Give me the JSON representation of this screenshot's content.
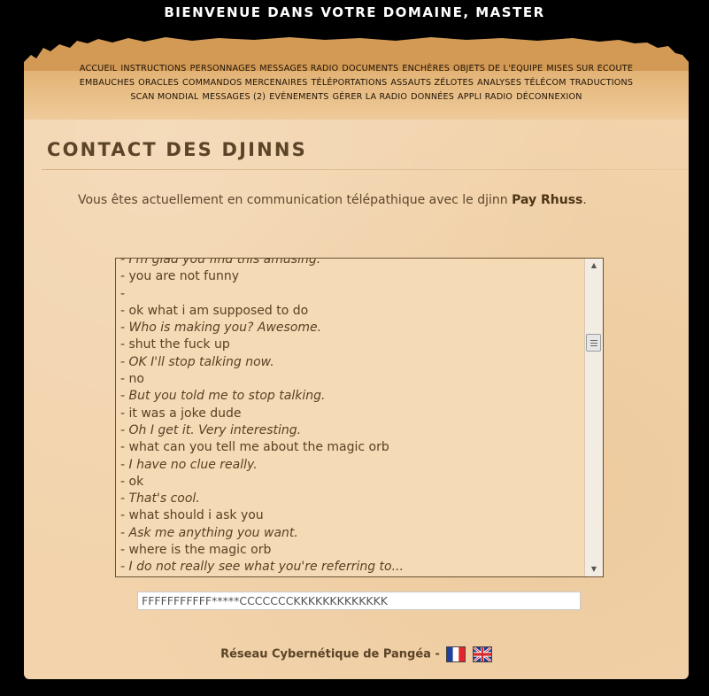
{
  "header": {
    "title": "BIENVENUE DANS VOTRE DOMAINE, MASTER"
  },
  "nav": {
    "row1": [
      "ACCUEIL",
      "INSTRUCTIONS",
      "PERSONNAGES",
      "MESSAGES RADIO",
      "DOCUMENTS",
      "ENCHÈRES",
      "OBJETS DE L'EQUIPE",
      "MISES SUR ECOUTE"
    ],
    "row2": [
      "EMBAUCHES",
      "ORACLES",
      "COMMANDOS MERCENAIRES",
      "TÉLÉPORTATIONS",
      "ASSAUTS ZÉLOTES",
      "ANALYSES TÉLÉCOM",
      "TRADUCTIONS"
    ],
    "row3": [
      "SCAN MONDIAL",
      "MESSAGES (2)",
      "EVÈNEMENTS",
      "GÉRER LA RADIO",
      "DONNÉES",
      "APPLI RADIO",
      "DÉCONNEXION"
    ]
  },
  "page": {
    "title": "CONTACT DES DJINNS",
    "intro_text": "Vous êtes actuellement en communication télépathique avec le djinn ",
    "djinn_name": "Pay Rhuss",
    "intro_end": "."
  },
  "chat": {
    "lines": [
      {
        "text": "- I'm glad you find this amusing.",
        "who": "bot"
      },
      {
        "text": "- you are not funny",
        "who": "user"
      },
      {
        "text": "-",
        "who": "user"
      },
      {
        "text": "- ok what i am supposed to do",
        "who": "user"
      },
      {
        "text": "- Who is making you? Awesome.",
        "who": "bot"
      },
      {
        "text": "- shut the fuck up",
        "who": "user"
      },
      {
        "text": "- OK I'll stop talking now.",
        "who": "bot"
      },
      {
        "text": "- no",
        "who": "user"
      },
      {
        "text": "- But you told me to stop talking.",
        "who": "bot"
      },
      {
        "text": "- it was a joke dude",
        "who": "user"
      },
      {
        "text": "- Oh I get it. Very interesting.",
        "who": "bot"
      },
      {
        "text": "- what can you tell me about the magic orb",
        "who": "user"
      },
      {
        "text": "- I have no clue really.",
        "who": "bot"
      },
      {
        "text": "- ok",
        "who": "user"
      },
      {
        "text": "- That's cool.",
        "who": "bot"
      },
      {
        "text": "- what should i ask you",
        "who": "user"
      },
      {
        "text": "- Ask me anything you want.",
        "who": "bot"
      },
      {
        "text": "- where is the magic orb",
        "who": "user"
      },
      {
        "text": "- I do not really see what you're referring to...",
        "who": "bot"
      }
    ]
  },
  "input": {
    "value": "FFFFFFFFFFF*****CCCCCCCKKKKKKKKKKKKK"
  },
  "footer": {
    "text": "Réseau Cybernétique de Pangéa -"
  },
  "icons": {
    "scroll_up": "triangle-up",
    "scroll_down": "triangle-down",
    "flag_fr": "french-flag",
    "flag_en": "uk-flag"
  },
  "colors": {
    "page_background": "#f2d3ab",
    "title_color": "#5b4427",
    "outer_background": "#000000"
  }
}
